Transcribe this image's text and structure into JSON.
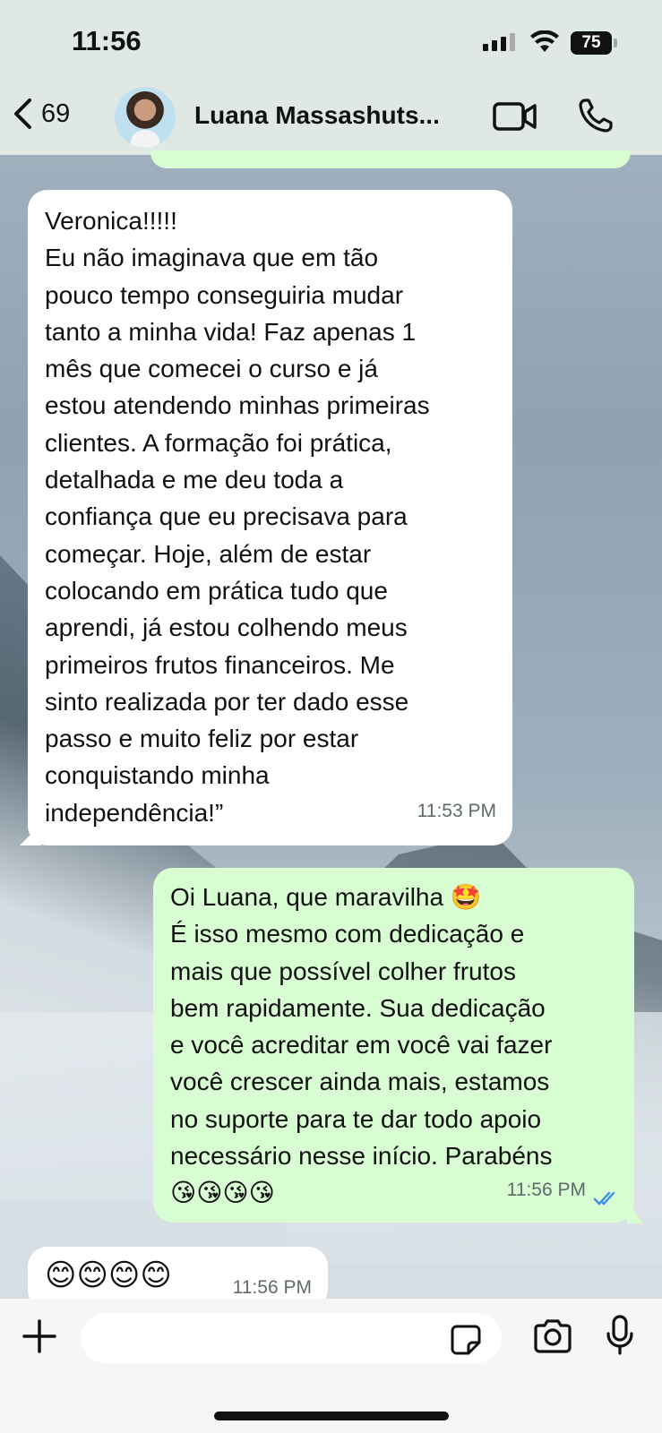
{
  "status_bar": {
    "time": "11:56",
    "battery": "75"
  },
  "header": {
    "back_count": "69",
    "contact_name": "Luana  Massashuts..."
  },
  "messages": [
    {
      "direction": "incoming",
      "text": "Veronica!!!!!\nEu não imaginava que em tão\npouco tempo conseguiria mudar\ntanto a minha vida! Faz apenas 1\nmês que comecei o curso e já\nestou atendendo minhas primeiras\nclientes. A formação foi prática,\ndetalhada e me deu toda a\nconfiança que eu precisava para\ncomeçar. Hoje, além de estar\ncolocando em prática tudo que\naprendi, já estou colhendo meus\nprimeiros frutos financeiros. Me\nsinto realizada por ter dado esse\npasso e muito feliz por estar\nconquistando minha\nindependência!”",
      "time": "11:53 PM"
    },
    {
      "direction": "outgoing",
      "text": "Oi Luana, que maravilha 🤩\nÉ isso mesmo com dedicação e\nmais que possível colher frutos\nbem rapidamente. Sua dedicação\ne você acreditar em você vai fazer\nvocê crescer ainda mais, estamos\nno suporte para te dar todo apoio\nnecessário nesse início. Parabéns\n😘😘😘😘",
      "time": "11:56 PM",
      "read": true
    },
    {
      "direction": "incoming",
      "text": "😊😊😊😊",
      "time": "11:56 PM"
    }
  ],
  "input": {
    "placeholder": ""
  },
  "colors": {
    "outgoing_bubble": "#d9fdd3",
    "incoming_bubble": "#ffffff",
    "read_ticks": "#3b8ee8"
  }
}
